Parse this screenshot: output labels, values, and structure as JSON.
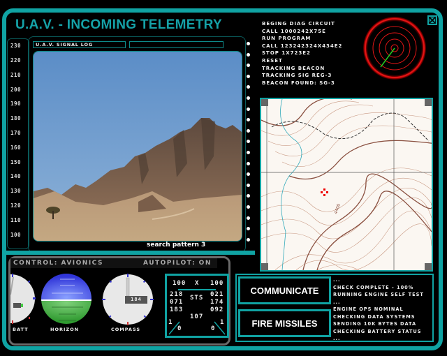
{
  "header": {
    "title": "U.A.V. - INCOMING TELEMETRY"
  },
  "altitude_scale": [
    "230",
    "220",
    "210",
    "200",
    "190",
    "180",
    "170",
    "160",
    "150",
    "140",
    "130",
    "120",
    "110",
    "100"
  ],
  "video": {
    "signal_log_label": "U.A.V. SIGNAL LOG",
    "signal_field_value": "",
    "caption": "search pattern 3"
  },
  "diag_log": [
    "BEGING DIAG CIRCUIT",
    "CALL 1000242X75E",
    "RUN PROGRAM",
    "CALL 123242324X434E2",
    "STOP 1X723E2",
    "RESET",
    "TRACKING BEACON",
    "TRACKING SIG REG-3",
    "BEACON FOUND: SG-3"
  ],
  "radar": {
    "icon": "radar-scope",
    "sweep_color": "#22cc22",
    "ring_color": "#dd1111"
  },
  "close_button": {
    "icon": "close-x-icon"
  },
  "map": {
    "icon": "topographic-map",
    "target_marker": "red-crosshair",
    "contour_label": "4400"
  },
  "control": {
    "label": "CONTROL: AVIONICS",
    "autopilot": "AUTOPILOT: ON"
  },
  "gauges": {
    "batt_label": "BATT",
    "horizon_label": "HORIZON",
    "compass_label": "COMPASS",
    "compass_value": "184"
  },
  "sts": {
    "top_left": "100",
    "top_mid": "X",
    "top_right": "100",
    "center_label": "STS",
    "left_values": [
      "218",
      "071",
      "183"
    ],
    "right_values": [
      "021",
      "174",
      "092"
    ],
    "bottom_center": "107",
    "left_fraction": {
      "num": "1",
      "den": "0"
    },
    "right_fraction": {
      "num": "1",
      "den": "0"
    }
  },
  "actions": {
    "communicate": "COMMUNICATE",
    "fire_missiles": "FIRE MISSILES"
  },
  "status_log": [
    "...",
    "CHECK COMPLETE - 100%",
    "RUNNING ENGINE SELF TEST",
    "...",
    "ENGINE OPS NOMINAL",
    "CHECKING DATA SYSTEMS",
    "SENDING 10K BYTES DATA",
    "CHECKING BATTERY STATUS",
    "..."
  ],
  "colors": {
    "accent": "#10a3a3",
    "title": "#15a2a8",
    "panel_grey": "#6a6a6a"
  }
}
